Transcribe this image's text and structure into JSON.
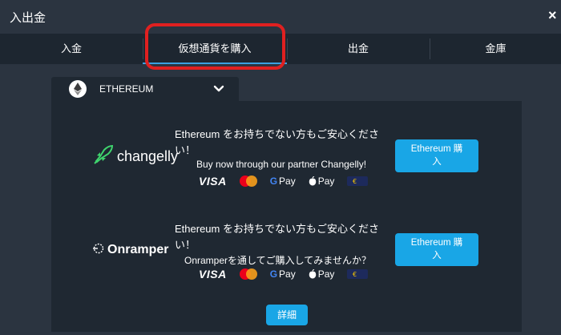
{
  "window": {
    "title": "入出金",
    "close_label": "×"
  },
  "tabs": [
    {
      "label": "入金"
    },
    {
      "label": "仮想通貨を購入"
    },
    {
      "label": "出金"
    },
    {
      "label": "金庫"
    }
  ],
  "coin_select": {
    "value": "ETHEREUM"
  },
  "providers": [
    {
      "name": "changelly",
      "desc_line1": "Ethereum をお持ちでない方もご安心くださ",
      "desc_line2": "い！",
      "desc_line3": "Buy now through our partner Changelly!",
      "button_line1": "Ethereum 購",
      "button_line2": "入"
    },
    {
      "name": "Onramper",
      "desc_line1": "Ethereum をお持ちでない方もご安心くださ",
      "desc_line2": "い！",
      "desc_line3": "Onramperを通してご購入してみませんか？",
      "button_line1": "Ethereum 購",
      "button_line2": "入"
    }
  ],
  "payment_methods": {
    "visa": "VISA",
    "gpay": "Pay",
    "applepay": "Pay",
    "sepa": "€"
  },
  "details_label": "詳細",
  "colors": {
    "accent": "#19a6e6",
    "highlight": "#e02020",
    "panel": "#1f2832",
    "background": "#2b3440"
  }
}
